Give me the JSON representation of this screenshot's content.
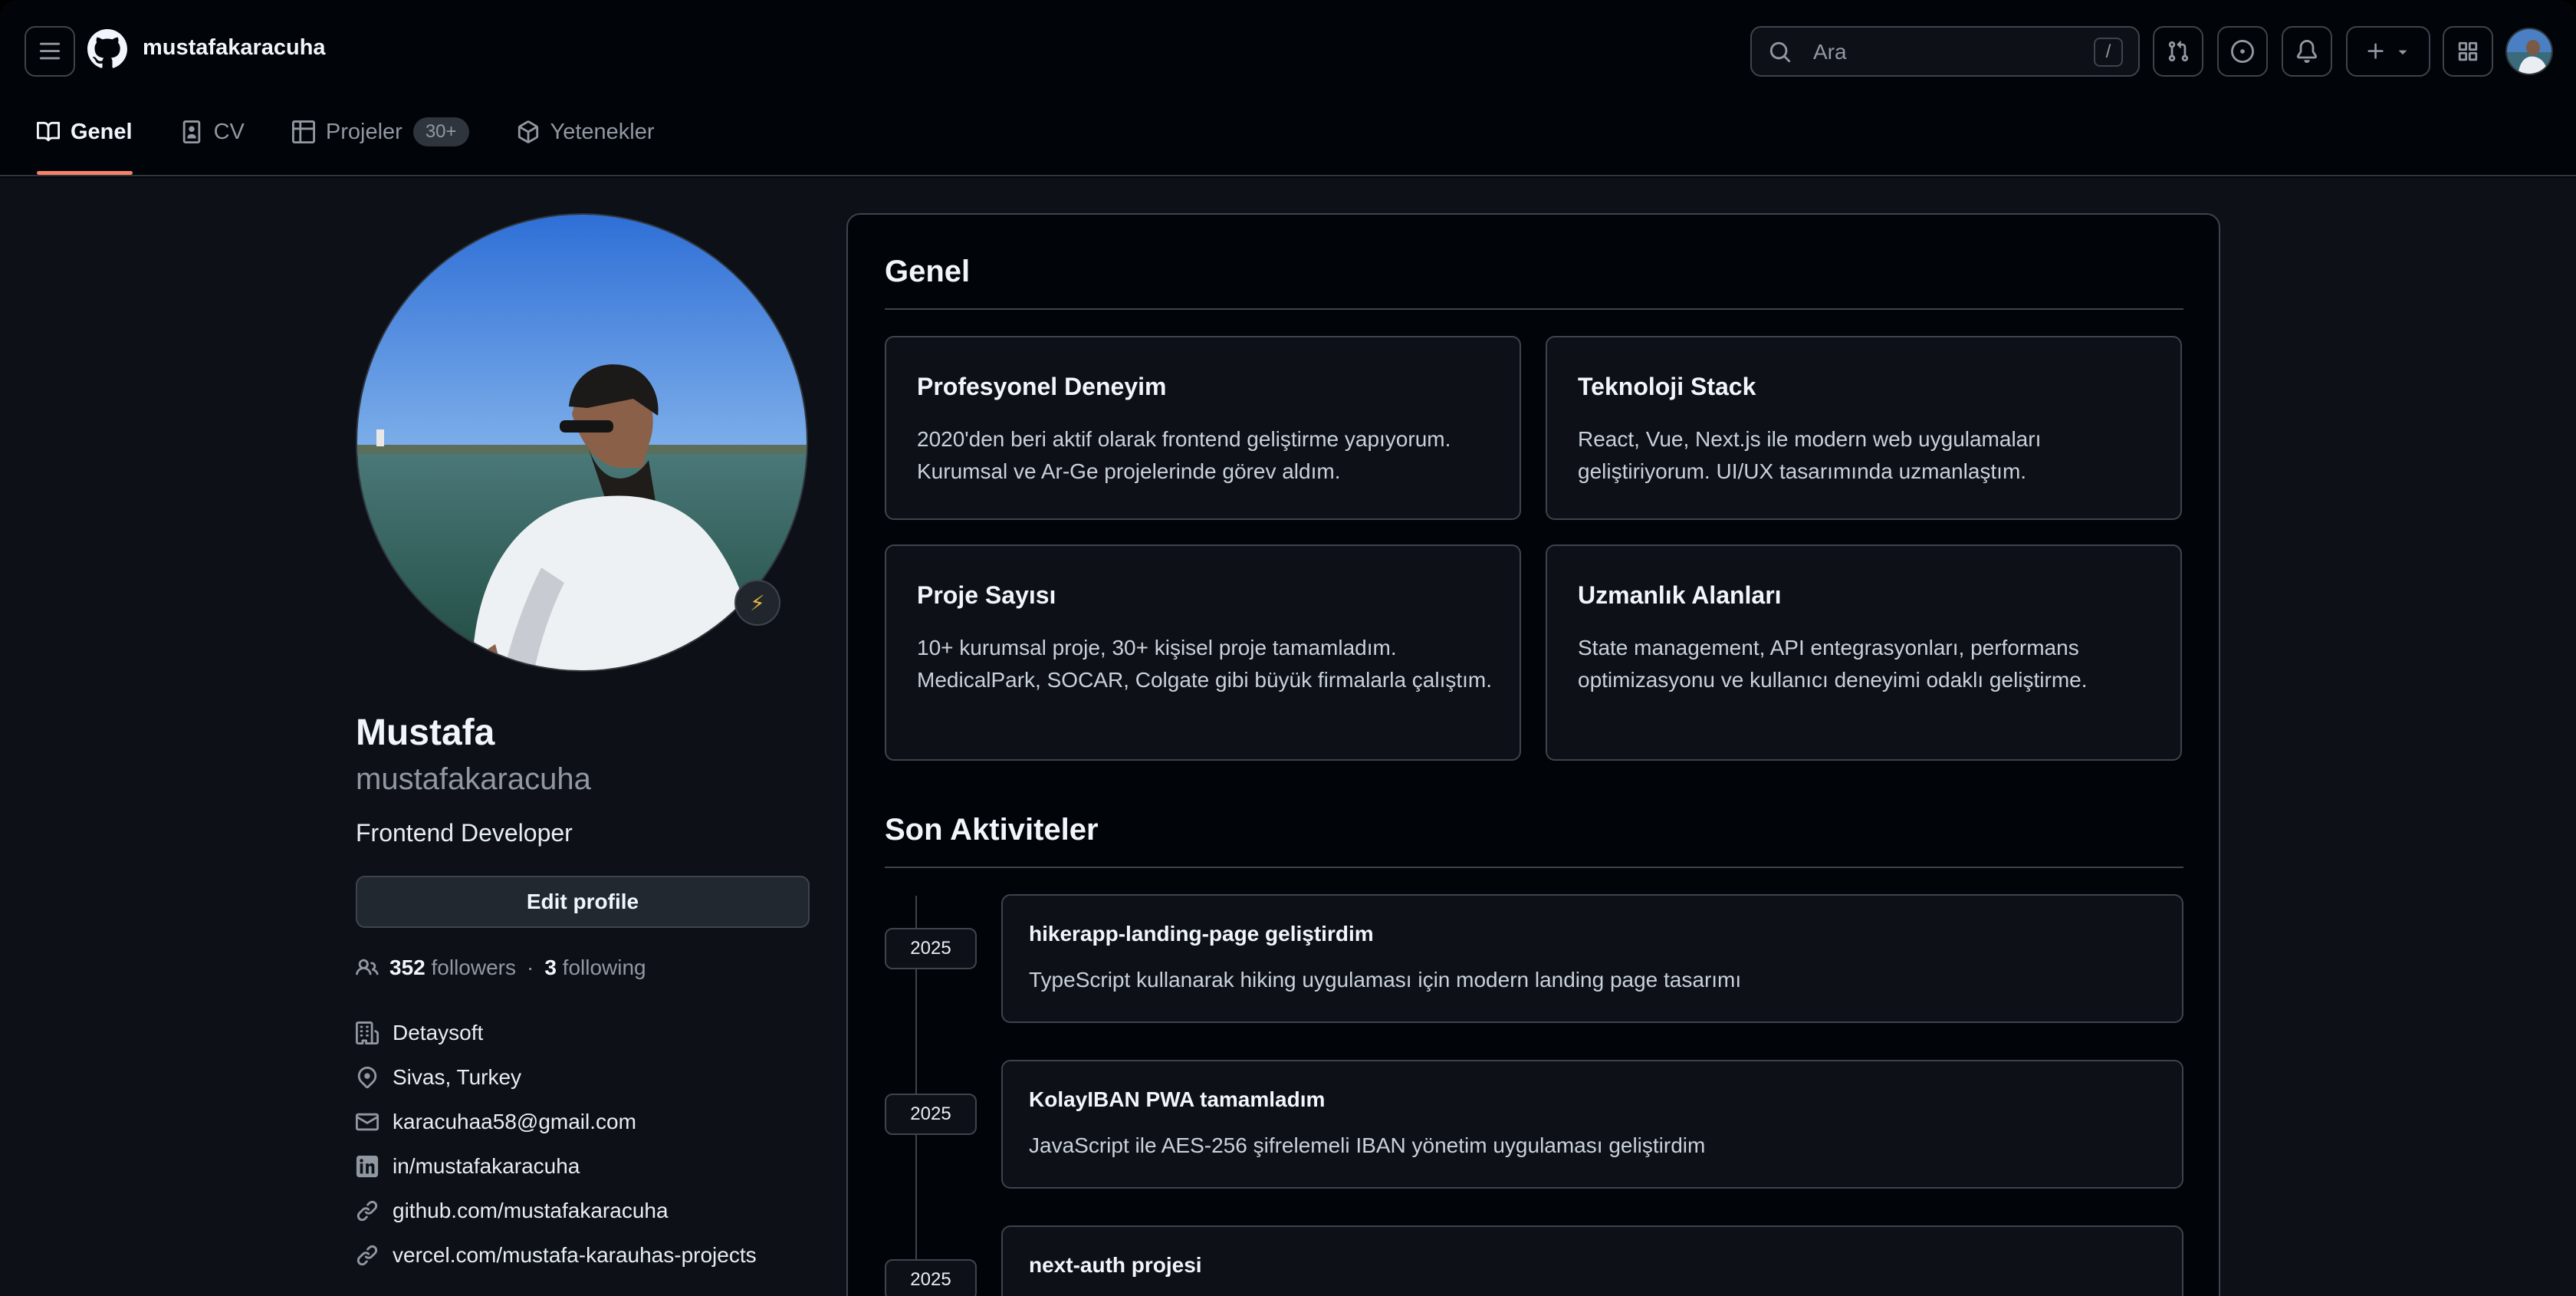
{
  "header": {
    "owner": "mustafakaracuha",
    "search_placeholder": "Ara",
    "search_shortcut": "/"
  },
  "tabs": [
    {
      "label": "Genel",
      "icon": "book-icon",
      "active": true
    },
    {
      "label": "CV",
      "icon": "person-card-icon"
    },
    {
      "label": "Projeler",
      "icon": "table-icon",
      "counter": "30+"
    },
    {
      "label": "Yetenekler",
      "icon": "package-icon"
    }
  ],
  "profile": {
    "name": "Mustafa",
    "login": "mustafakaracuha",
    "bio": "Frontend Developer",
    "edit_label": "Edit profile",
    "status_emoji": "⚡",
    "followers_count": "352",
    "followers_label": "followers",
    "separator": "·",
    "following_count": "3",
    "following_label": "following",
    "company": "Detaysoft",
    "location": "Sivas, Turkey",
    "email": "karacuhaa58@gmail.com",
    "linkedin": "in/mustafakaracuha",
    "link1": "github.com/mustafakaracuha",
    "link2": "vercel.com/mustafa-karauhas-projects"
  },
  "overview": {
    "title": "Genel",
    "cards": [
      {
        "title": "Profesyonel Deneyim",
        "text": "2020'den beri aktif olarak frontend geliştirme yapıyorum. Kurumsal ve Ar-Ge projelerinde görev aldım."
      },
      {
        "title": "Teknoloji Stack",
        "text": "React, Vue, Next.js ile modern web uygulamaları geliştiriyorum. UI/UX tasarımında uzmanlaştım."
      },
      {
        "title": "Proje Sayısı",
        "text": "10+ kurumsal proje, 30+ kişisel proje tamamladım. MedicalPark, SOCAR, Colgate gibi büyük firmalarla çalıştım."
      },
      {
        "title": "Uzmanlık Alanları",
        "text": "State management, API entegrasyonları, performans optimizasyonu ve kullanıcı deneyimi odaklı geliştirme."
      }
    ]
  },
  "activities": {
    "title": "Son Aktiviteler",
    "items": [
      {
        "year": "2025",
        "title": "hikerapp-landing-page geliştirdim",
        "text": "TypeScript kullanarak hiking uygulaması için modern landing page tasarımı"
      },
      {
        "year": "2025",
        "title": "KolayIBAN PWA tamamladım",
        "text": "JavaScript ile AES-256 şifrelemeli IBAN yönetim uygulaması geliştirdim"
      },
      {
        "year": "2025",
        "title": "next-auth projesi",
        "text": ""
      }
    ]
  },
  "colors": {
    "background": "#0d1117",
    "header_bg": "#010409",
    "border": "#3d444d",
    "tab_underline": "#f78166",
    "text_primary": "#f0f6fc",
    "text_muted": "#9198a1"
  }
}
